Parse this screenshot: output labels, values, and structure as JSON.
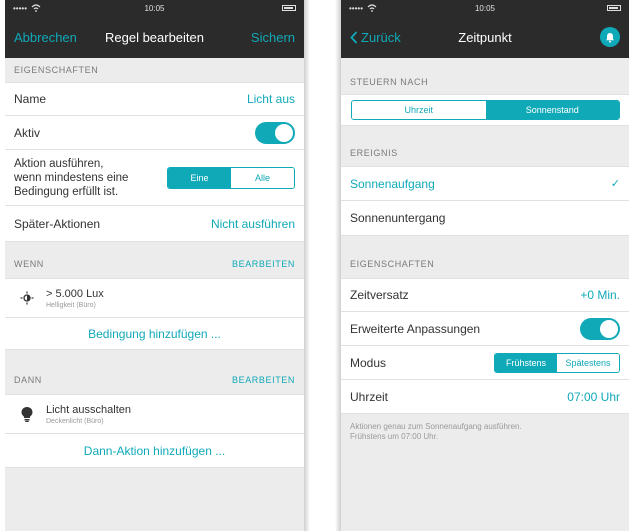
{
  "left": {
    "statusbar": {
      "signal": "•••••",
      "time": "10:05"
    },
    "navbar": {
      "cancel": "Abbrechen",
      "title": "Regel bearbeiten",
      "save": "Sichern"
    },
    "properties": {
      "header": "EIGENSCHAFTEN",
      "name_label": "Name",
      "name_value": "Licht aus",
      "active_label": "Aktiv",
      "active_on": true,
      "action_label_1": "Aktion ausführen,",
      "action_label_2": "wenn mindestens eine",
      "action_label_3": "Bedingung erfüllt ist.",
      "seg_one": "Eine",
      "seg_all": "Alle",
      "later_label": "Später-Aktionen",
      "later_value": "Nicht ausführen"
    },
    "when": {
      "header": "WENN",
      "edit": "BEARBEITEN",
      "condition_title": "> 5.000 Lux",
      "condition_subtitle": "Helligkeit (Büro)",
      "add": "Bedingung hinzufügen ..."
    },
    "then": {
      "header": "DANN",
      "edit": "BEARBEITEN",
      "action_title": "Licht ausschalten",
      "action_subtitle": "Deckenlicht (Büro)",
      "add": "Dann-Aktion hinzufügen ..."
    }
  },
  "right": {
    "statusbar": {
      "signal": "•••••",
      "time": "10:05"
    },
    "navbar": {
      "back": "Zurück",
      "title": "Zeitpunkt"
    },
    "control": {
      "header": "STEUERN NACH",
      "opt_time": "Uhrzeit",
      "opt_sun": "Sonnenstand"
    },
    "event": {
      "header": "EREIGNIS",
      "sunrise": "Sonnenaufgang",
      "sunset": "Sonnenuntergang",
      "check": "✓"
    },
    "properties": {
      "header": "EIGENSCHAFTEN",
      "offset_label": "Zeitversatz",
      "offset_value": "+0 Min.",
      "advanced_label": "Erweiterte Anpassungen",
      "mode_label": "Modus",
      "mode_early": "Frühstens",
      "mode_late": "Spätestens",
      "time_label": "Uhrzeit",
      "time_value": "07:00 Uhr"
    },
    "footnote_1": "Aktionen genau zum Sonnenaufgang ausführen.",
    "footnote_2": "Frühstens um 07:00 Uhr."
  },
  "colors": {
    "accent": "#10a9b8",
    "navbar": "#2b2b2b",
    "background": "#ececec"
  },
  "icons": [
    "wifi-icon",
    "battery-icon",
    "chevron-left-icon",
    "bell-icon",
    "brightness-icon",
    "lightbulb-icon",
    "checkmark-icon"
  ]
}
